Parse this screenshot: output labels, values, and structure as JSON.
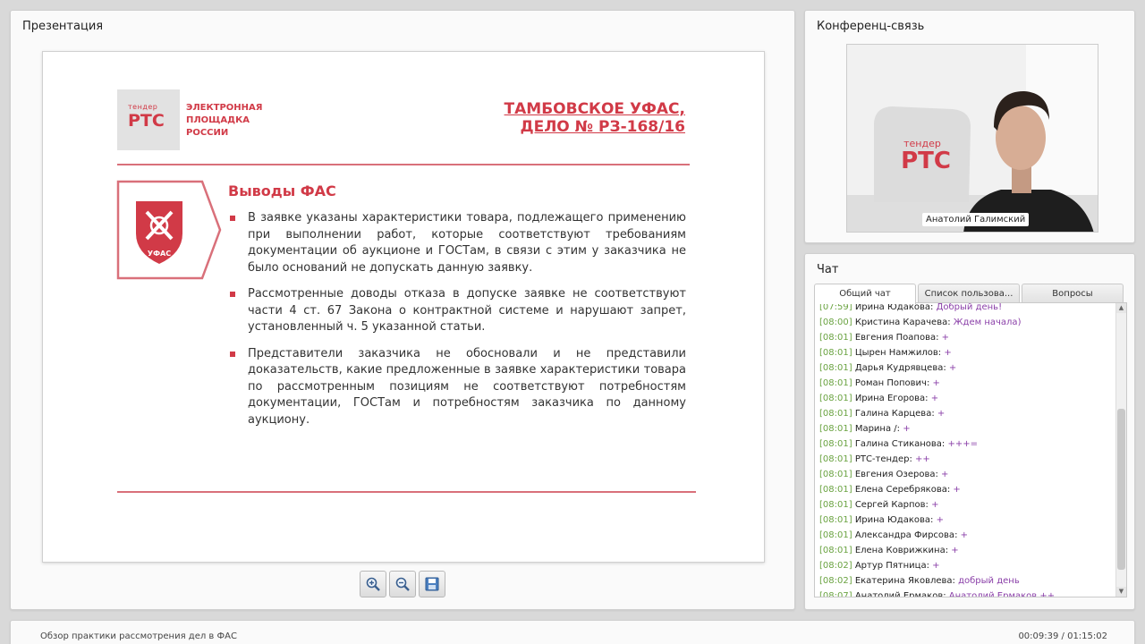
{
  "presentation": {
    "title": "Презентация",
    "slide": {
      "logo_small": "тендер",
      "logo_big": "РТС",
      "logo_text": [
        "ЭЛЕКТРОННАЯ",
        "ПЛОЩАДКА",
        "РОССИИ"
      ],
      "case_title": [
        "ТАМБОВСКОЕ УФАС,",
        "ДЕЛО № РЗ-168/16"
      ],
      "emblem_label": "УФАС",
      "section_title": "Выводы ФАС",
      "bullets": [
        "В заявке указаны характеристики товара, подлежащего применению при выполнении работ, которые соответствуют требованиям документации об аукционе и ГОСТам, в связи с этим у заказчика не было оснований не допускать данную заявку.",
        "Рассмотренные доводы отказа в допуске заявке не соответствуют части 4 ст. 67 Закона о контрактной системе и нарушают запрет, установленный ч. 5 указанной статьи.",
        "Представители заказчика не обосновали и не представили доказательств, какие предложенные в заявке характеристики товара по рассмотренным позициям не соответствуют потребностям документации, ГОСТам и потребностям заказчика по данному аукциону."
      ]
    },
    "toolbar": {
      "zoom_in_icon": "zoom-in-icon",
      "zoom_out_icon": "zoom-out-icon",
      "save_icon": "save-icon"
    }
  },
  "conference": {
    "title": "Конференц-связь",
    "video_logo_small": "тендер",
    "video_logo_big": "РТС",
    "speaker_name": "Анатолий Галимский"
  },
  "chat": {
    "title": "Чат",
    "tabs": [
      "Общий чат",
      "Список пользова...",
      "Вопросы"
    ],
    "messages": [
      {
        "time": "[07:59]",
        "user": "Ирина Юдакова:",
        "text": "Добрый день!"
      },
      {
        "time": "[08:00]",
        "user": "Кристина Карачева:",
        "text": "Ждем начала)"
      },
      {
        "time": "[08:01]",
        "user": "Евгения Поапова:",
        "text": "+"
      },
      {
        "time": "[08:01]",
        "user": "Цырен Намжилов:",
        "text": "+"
      },
      {
        "time": "[08:01]",
        "user": "Дарья Кудрявцева:",
        "text": "+"
      },
      {
        "time": "[08:01]",
        "user": "Роман Попович:",
        "text": "+"
      },
      {
        "time": "[08:01]",
        "user": "Ирина Егорова:",
        "text": "+"
      },
      {
        "time": "[08:01]",
        "user": "Галина Карцева:",
        "text": "+"
      },
      {
        "time": "[08:01]",
        "user": "Марина /:",
        "text": "+"
      },
      {
        "time": "[08:01]",
        "user": "Галина Стиканова:",
        "text": "+++="
      },
      {
        "time": "[08:01]",
        "user": "РТС-тендер:",
        "text": "++"
      },
      {
        "time": "[08:01]",
        "user": "Евгения Озерова:",
        "text": "+"
      },
      {
        "time": "[08:01]",
        "user": "Елена Серебрякова:",
        "text": "+"
      },
      {
        "time": "[08:01]",
        "user": "Сергей Карпов:",
        "text": "+"
      },
      {
        "time": "[08:01]",
        "user": "Ирина Юдакова:",
        "text": "+"
      },
      {
        "time": "[08:01]",
        "user": "Александра Фирсова:",
        "text": "+"
      },
      {
        "time": "[08:01]",
        "user": "Елена Коврижкина:",
        "text": "+"
      },
      {
        "time": "[08:02]",
        "user": "Артур Пятница:",
        "text": "+"
      },
      {
        "time": "[08:02]",
        "user": "Екатерина Яковлева:",
        "text": "добрый день"
      },
      {
        "time": "[08:07]",
        "user": "Анатолий Ермаков:",
        "text": "Анатолий Ермаков ++"
      }
    ]
  },
  "footer": {
    "title": "Обзор практики рассмотрения дел в ФАС",
    "time": "00:09:39 / 01:15:02"
  },
  "colors": {
    "brand_red": "#d13a47",
    "timestamp_green": "#6aa341",
    "message_purple": "#8a3fa8"
  }
}
